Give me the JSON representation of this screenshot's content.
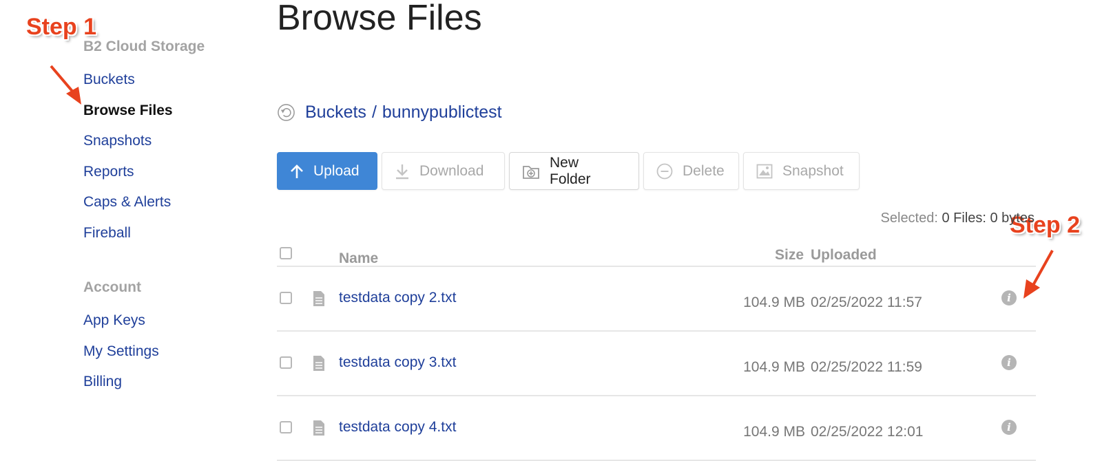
{
  "sidebar": {
    "section1_title": "B2 Cloud Storage",
    "items1": [
      {
        "label": "Buckets"
      },
      {
        "label": "Browse Files"
      },
      {
        "label": "Snapshots"
      },
      {
        "label": "Reports"
      },
      {
        "label": "Caps & Alerts"
      },
      {
        "label": "Fireball"
      }
    ],
    "section2_title": "Account",
    "items2": [
      {
        "label": "App Keys"
      },
      {
        "label": "My Settings"
      },
      {
        "label": "Billing"
      }
    ],
    "active_item": "Browse Files"
  },
  "annotations": {
    "step1": "Step 1",
    "step2": "Step 2",
    "color": "#e8421e"
  },
  "main": {
    "title": "Browse Files",
    "breadcrumb": {
      "root": "Buckets",
      "separator": "/",
      "current": "bunnypublictest",
      "icon": "back-icon"
    },
    "toolbar": {
      "upload": "Upload",
      "download": "Download",
      "new_folder": "New Folder",
      "delete": "Delete",
      "snapshot": "Snapshot"
    },
    "selected": {
      "label": "Selected:",
      "value": "0 Files: 0 bytes"
    },
    "table": {
      "columns": {
        "name": "Name",
        "size": "Size",
        "uploaded": "Uploaded"
      },
      "rows": [
        {
          "name": "testdata copy 2.txt",
          "size": "104.9 MB",
          "uploaded": "02/25/2022 11:57",
          "info": "i"
        },
        {
          "name": "testdata copy 3.txt",
          "size": "104.9 MB",
          "uploaded": "02/25/2022 11:59",
          "info": "i"
        },
        {
          "name": "testdata copy 4.txt",
          "size": "104.9 MB",
          "uploaded": "02/25/2022 12:01",
          "info": "i"
        }
      ]
    }
  },
  "colors": {
    "link": "#1f3f9a",
    "primary_button": "#3f86d6",
    "muted": "#a3a3a3"
  }
}
